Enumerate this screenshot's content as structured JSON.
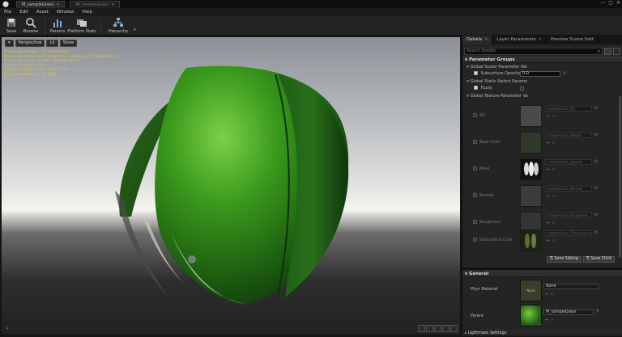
{
  "titlebar": {
    "tabs": [
      {
        "label": "M_sampleGrass",
        "active": true
      },
      {
        "label": "MI_sampleGrass",
        "active": false
      }
    ]
  },
  "menu": [
    "File",
    "Edit",
    "Asset",
    "Window",
    "Help"
  ],
  "toolbar": {
    "buttons": [
      {
        "label": "Save",
        "icon": "save-icon"
      },
      {
        "label": "Browse",
        "icon": "browse-icon"
      },
      {
        "label": "Params",
        "icon": "params-icon"
      },
      {
        "label": "Platform Stats",
        "icon": "platform-stats-icon"
      },
      {
        "label": "Hierarchy",
        "icon": "hierarchy-icon"
      }
    ]
  },
  "viewport": {
    "view_mode": "Perspective",
    "lighting": "Lit",
    "show": "Show",
    "stats": [
      "Base pass shader: 172 instructions",
      "Base pass shader with Volumetric Lightmap: 207 instructions",
      "Base pass vertex shader: 78 instructions",
      "Texture samplers: 8/16",
      "Texture Lookups (Est.): VS(0), PS(9)",
      "Num Interpolators: 1/8 (0/8)"
    ]
  },
  "details": {
    "tabs": [
      "Details",
      "Layer Parameters",
      "Preview Scene Sett"
    ],
    "search_placeholder": "Search Details",
    "parameter_groups_label": "Parameter Groups",
    "scalar_group_label": "Global Scalar Parameter Val",
    "subsurface_opacity_label": "Subsurface Opacity",
    "subsurface_opacity_value": "0.0",
    "static_switch_group_label": "Global Static Switch Parame",
    "fuzzy_label": "Fuzzy",
    "texture_group_label": "Global Texture Parameter Va",
    "texture_params": [
      {
        "label": "AO",
        "asset": "sampleGrass_AO"
      },
      {
        "label": "Base Color",
        "asset": "sampleGrass_Albedo"
      },
      {
        "label": "Mask",
        "asset": "sampleGrass_Opacity"
      },
      {
        "label": "Normal",
        "asset": "sampleGrass_Normal"
      },
      {
        "label": "Roughness",
        "asset": "sampleGrass_Roughness"
      },
      {
        "label": "Subsurface Color",
        "asset": "sampleGrass_Translucency"
      }
    ],
    "save_sibling_label": "Save Sibling",
    "save_child_label": "Save Child",
    "general_label": "General",
    "phys_material_label": "Phys Material",
    "phys_material_value": "None",
    "phys_thumb_label": "None",
    "parent_label": "Parent",
    "parent_value": "M_sampleGrass",
    "lightmass_label": "Lightmass Settings"
  },
  "colors": {
    "accent": "#cc9a2c",
    "stats_text": "#d8c24a",
    "panel_bg": "#242424"
  }
}
